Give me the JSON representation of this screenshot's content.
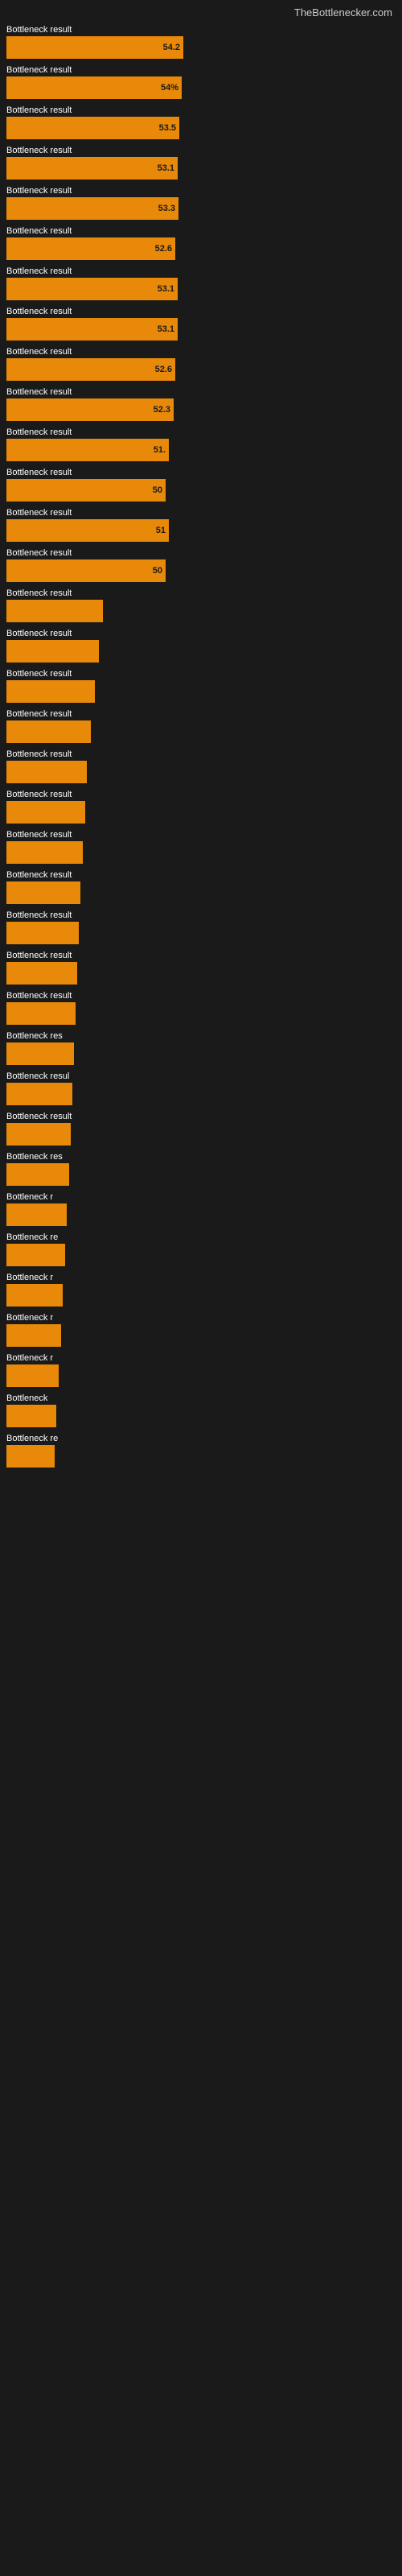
{
  "header": {
    "site": "TheBottlenecker.com"
  },
  "items": [
    {
      "label": "Bottleneck result",
      "value": "54.2",
      "barWidth": 220
    },
    {
      "label": "Bottleneck result",
      "value": "54%",
      "barWidth": 218
    },
    {
      "label": "Bottleneck result",
      "value": "53.5",
      "barWidth": 215
    },
    {
      "label": "Bottleneck result",
      "value": "53.1",
      "barWidth": 213
    },
    {
      "label": "Bottleneck result",
      "value": "53.3",
      "barWidth": 214
    },
    {
      "label": "Bottleneck result",
      "value": "52.6",
      "barWidth": 210
    },
    {
      "label": "Bottleneck result",
      "value": "53.1",
      "barWidth": 213
    },
    {
      "label": "Bottleneck result",
      "value": "53.1",
      "barWidth": 213
    },
    {
      "label": "Bottleneck result",
      "value": "52.6",
      "barWidth": 210
    },
    {
      "label": "Bottleneck result",
      "value": "52.3",
      "barWidth": 208
    },
    {
      "label": "Bottleneck result",
      "value": "51.",
      "barWidth": 202
    },
    {
      "label": "Bottleneck result",
      "value": "50",
      "barWidth": 198
    },
    {
      "label": "Bottleneck result",
      "value": "51",
      "barWidth": 202
    },
    {
      "label": "Bottleneck result",
      "value": "50",
      "barWidth": 198
    },
    {
      "label": "Bottleneck result",
      "value": "",
      "barWidth": 120
    },
    {
      "label": "Bottleneck result",
      "value": "",
      "barWidth": 115
    },
    {
      "label": "Bottleneck result",
      "value": "",
      "barWidth": 110
    },
    {
      "label": "Bottleneck result",
      "value": "",
      "barWidth": 105
    },
    {
      "label": "Bottleneck result",
      "value": "",
      "barWidth": 100
    },
    {
      "label": "Bottleneck result",
      "value": "",
      "barWidth": 98
    },
    {
      "label": "Bottleneck result",
      "value": "",
      "barWidth": 95
    },
    {
      "label": "Bottleneck result",
      "value": "",
      "barWidth": 92
    },
    {
      "label": "Bottleneck result",
      "value": "",
      "barWidth": 90
    },
    {
      "label": "Bottleneck result",
      "value": "",
      "barWidth": 88
    },
    {
      "label": "Bottleneck result",
      "value": "",
      "barWidth": 86
    },
    {
      "label": "Bottleneck res",
      "value": "",
      "barWidth": 84
    },
    {
      "label": "Bottleneck resul",
      "value": "",
      "barWidth": 82
    },
    {
      "label": "Bottleneck result",
      "value": "",
      "barWidth": 80
    },
    {
      "label": "Bottleneck res",
      "value": "",
      "barWidth": 78
    },
    {
      "label": "Bottleneck r",
      "value": "",
      "barWidth": 75
    },
    {
      "label": "Bottleneck re",
      "value": "",
      "barWidth": 73
    },
    {
      "label": "Bottleneck r",
      "value": "",
      "barWidth": 70
    },
    {
      "label": "Bottleneck r",
      "value": "",
      "barWidth": 68
    },
    {
      "label": "Bottleneck r",
      "value": "",
      "barWidth": 65
    },
    {
      "label": "Bottleneck",
      "value": "",
      "barWidth": 62
    },
    {
      "label": "Bottleneck re",
      "value": "",
      "barWidth": 60
    }
  ]
}
